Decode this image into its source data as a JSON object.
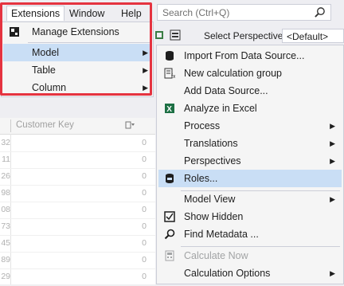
{
  "menubar": {
    "items": [
      "Extensions",
      "Window",
      "Help"
    ],
    "search_placeholder": "Search (Ctrl+Q)"
  },
  "toolbar": {
    "perspective_label": "Select Perspective",
    "perspective_value": "<Default>"
  },
  "grid": {
    "column_header": "Customer Key",
    "rows": [
      {
        "a": "32",
        "b": "0"
      },
      {
        "a": "11",
        "b": "0"
      },
      {
        "a": "26",
        "b": "0"
      },
      {
        "a": "98",
        "b": "0"
      },
      {
        "a": "08",
        "b": "0"
      },
      {
        "a": "73",
        "b": "0"
      },
      {
        "a": "45",
        "b": "0"
      },
      {
        "a": "89",
        "b": "0"
      },
      {
        "a": "29",
        "b": "0"
      }
    ]
  },
  "extensions_menu": {
    "items": [
      {
        "label": "Manage Extensions",
        "icon": "manage-extensions-icon"
      },
      {
        "label": "Model",
        "submenu": true
      },
      {
        "label": "Table",
        "submenu": true
      },
      {
        "label": "Column",
        "submenu": true
      }
    ]
  },
  "model_menu": {
    "items": [
      {
        "label": "Import From Data Source...",
        "icon": "database-icon"
      },
      {
        "label": "New calculation group",
        "icon": "calculation-group-icon"
      },
      {
        "label": "Add Data Source...",
        "icon": ""
      },
      {
        "label": "Analyze in Excel",
        "icon": "excel-icon"
      },
      {
        "label": "Process",
        "submenu": true
      },
      {
        "label": "Translations",
        "submenu": true
      },
      {
        "label": "Perspectives",
        "submenu": true
      },
      {
        "label": "Roles...",
        "icon": "roles-icon"
      },
      {
        "label": "Model View",
        "submenu": true
      },
      {
        "label": "Show Hidden",
        "icon": "show-hidden-icon"
      },
      {
        "label": "Find Metadata ...",
        "icon": "find-icon"
      },
      {
        "label": "Calculate Now",
        "icon": "calculator-icon",
        "disabled": true
      },
      {
        "label": "Calculation Options",
        "submenu": true
      }
    ]
  },
  "colors": {
    "highlight": "#c9def5",
    "annotation_border": "#e53340",
    "menu_bg": "#f5f5f5"
  }
}
